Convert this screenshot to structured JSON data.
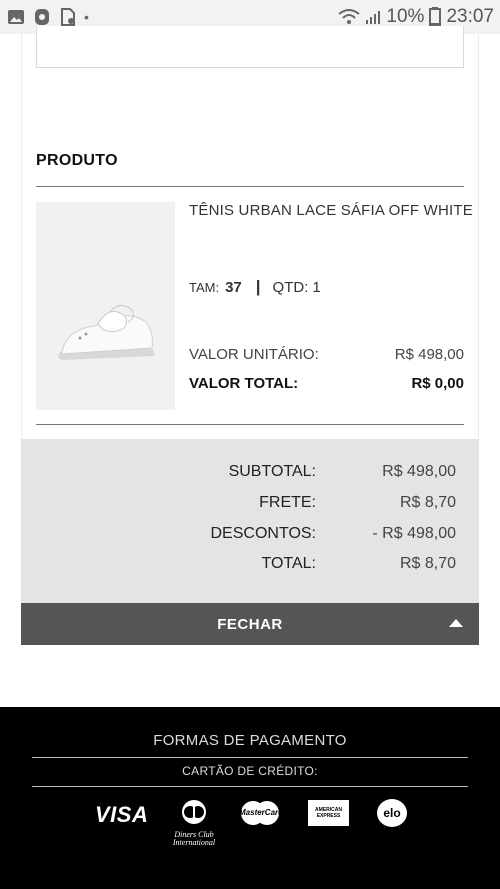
{
  "status_bar": {
    "battery": "10%",
    "time": "23:07",
    "icons": [
      "gallery-icon",
      "shield-icon",
      "file-icon",
      "dot-icon",
      "wifi-icon",
      "signal-icon",
      "battery-icon"
    ]
  },
  "product_section": {
    "title": "PRODUTO",
    "name": "TÊNIS URBAN LACE SÁFIA OFF WHITE",
    "size_label": "TAM:",
    "size_value": "37",
    "separator": "|",
    "qty_label": "QTD:",
    "qty_value": "1",
    "unit_price_label": "VALOR UNITÁRIO:",
    "unit_price_value": "R$ 498,00",
    "total_label": "VALOR TOTAL:",
    "total_value": "R$ 0,00"
  },
  "totals": {
    "subtotal_label": "SUBTOTAL:",
    "subtotal_value": "R$ 498,00",
    "shipping_label": "FRETE:",
    "shipping_value": "R$ 8,70",
    "discount_label": "DESCONTOS:",
    "discount_value": "- R$ 498,00",
    "total_label": "TOTAL:",
    "total_value": "R$ 8,70"
  },
  "close_button": {
    "label": "FECHAR",
    "icon": "caret-up-icon"
  },
  "footer": {
    "title": "FORMAS DE PAGAMENTO",
    "subtitle": "CARTÃO DE CRÉDITO:",
    "cards": [
      {
        "name": "visa",
        "label": "VISA"
      },
      {
        "name": "diners",
        "label": "Diners Club International"
      },
      {
        "name": "mastercard",
        "label": "MasterCard"
      },
      {
        "name": "amex",
        "label": "AMERICAN EXPRESS"
      },
      {
        "name": "elo",
        "label": "elo"
      }
    ]
  },
  "colors": {
    "close_bar": "#555555",
    "totals_bg": "#e4e4e4",
    "footer_bg": "#000000"
  }
}
